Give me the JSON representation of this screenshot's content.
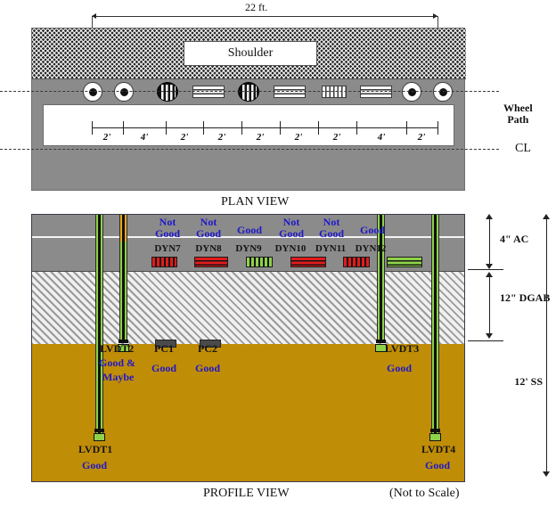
{
  "figure": {
    "plan_caption": "PLAN VIEW",
    "profile_caption": "PROFILE VIEW",
    "scale_note": "(Not to Scale)"
  },
  "plan": {
    "overall_dimension": "22 ft.",
    "shoulder_label": "Shoulder",
    "wheel_path_label_line1": "Wheel",
    "wheel_path_label_line2": "Path",
    "centerline_label": "CL",
    "segments": [
      {
        "label": "2'",
        "feet": 2
      },
      {
        "label": "4'",
        "feet": 4
      },
      {
        "label": "2'",
        "feet": 2
      },
      {
        "label": "2'",
        "feet": 2
      },
      {
        "label": "2'",
        "feet": 2
      },
      {
        "label": "2'",
        "feet": 2
      },
      {
        "label": "2'",
        "feet": 2
      },
      {
        "label": "4'",
        "feet": 4
      },
      {
        "label": "2'",
        "feet": 2
      }
    ],
    "sensor_icons": [
      {
        "name": "lvdt-circle-white",
        "type": "circle-white"
      },
      {
        "name": "lvdt-circle-white",
        "type": "circle-white"
      },
      {
        "name": "dyn-circle-black",
        "type": "circle-black"
      },
      {
        "name": "dyn-bar-horizontal",
        "type": "bar-horizontal"
      },
      {
        "name": "dyn-circle-black",
        "type": "circle-black"
      },
      {
        "name": "dyn-bar-horizontal",
        "type": "bar-horizontal"
      },
      {
        "name": "dyn-bar-vertical",
        "type": "bar-vertical"
      },
      {
        "name": "dyn-bar-horizontal",
        "type": "bar-horizontal"
      },
      {
        "name": "lvdt-circle-white",
        "type": "circle-white"
      },
      {
        "name": "lvdt-circle-white",
        "type": "circle-white"
      }
    ]
  },
  "profile": {
    "layers": [
      {
        "id": "ac",
        "dim_label": "4\" AC",
        "color": "#8b8b8b"
      },
      {
        "id": "dgab",
        "dim_label": "12\" DGAB",
        "color": "#f0f0f0"
      },
      {
        "id": "ss",
        "dim_label": "12' SS",
        "color": "#c08d06"
      }
    ],
    "dyn_sensors": [
      {
        "id": "DYN7",
        "status": "Not Good",
        "status_line1": "Not",
        "status_line2": "Good",
        "pattern": "vertical-red"
      },
      {
        "id": "DYN8",
        "status": "Not Good",
        "status_line1": "Not",
        "status_line2": "Good",
        "pattern": "horizontal-red"
      },
      {
        "id": "DYN9",
        "status": "Good",
        "status_line1": "",
        "status_line2": "Good",
        "pattern": "vertical-green"
      },
      {
        "id": "DYN10",
        "status": "Not Good",
        "status_line1": "Not",
        "status_line2": "Good",
        "pattern": "horizontal-red"
      },
      {
        "id": "DYN11",
        "status": "Not Good",
        "status_line1": "Not",
        "status_line2": "Good",
        "pattern": "vertical-red"
      },
      {
        "id": "DYN12",
        "status": "Good",
        "status_line1": "",
        "status_line2": "Good",
        "pattern": "horizontal-green"
      }
    ],
    "lvdts": [
      {
        "id": "LVDT1",
        "status_line1": "Good",
        "status_line2": ""
      },
      {
        "id": "LVDT2",
        "status_line1": "Good &",
        "status_line2": "Maybe"
      },
      {
        "id": "LVDT3",
        "status_line1": "Good",
        "status_line2": ""
      },
      {
        "id": "LVDT4",
        "status_line1": "Good",
        "status_line2": ""
      }
    ],
    "pressure_cells": [
      {
        "id": "PC1",
        "status": "Good"
      },
      {
        "id": "PC2",
        "status": "Good"
      }
    ]
  },
  "colors": {
    "good": "#2018c8",
    "asphalt": "#8b8b8b",
    "base": "#f0f0f0",
    "subgrade": "#c08d06",
    "rod_green": "#8ed24a",
    "rod_orange": "#f0a91a",
    "gauge_red": "#e01b1b"
  }
}
